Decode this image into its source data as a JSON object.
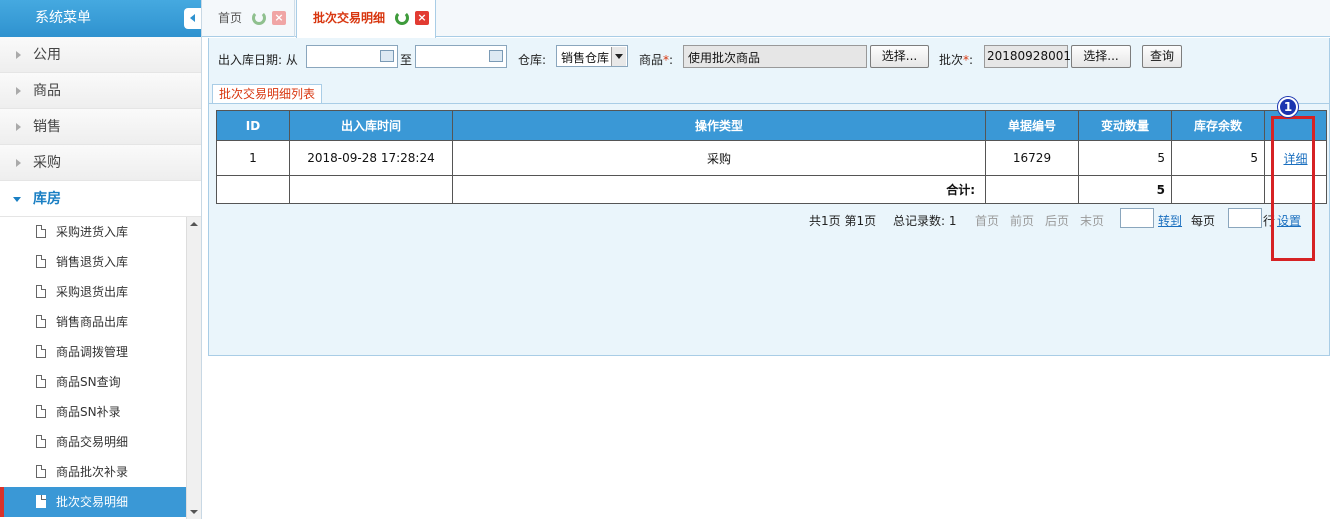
{
  "sidebar": {
    "title": "系统菜单",
    "groups": [
      {
        "label": "公用"
      },
      {
        "label": "商品"
      },
      {
        "label": "销售"
      },
      {
        "label": "采购"
      },
      {
        "label": "库房"
      }
    ],
    "items": [
      {
        "label": "采购进货入库"
      },
      {
        "label": "销售退货入库"
      },
      {
        "label": "采购退货出库"
      },
      {
        "label": "销售商品出库"
      },
      {
        "label": "商品调拨管理"
      },
      {
        "label": "商品SN查询"
      },
      {
        "label": "商品SN补录"
      },
      {
        "label": "商品交易明细"
      },
      {
        "label": "商品批次补录"
      },
      {
        "label": "批次交易明细"
      }
    ]
  },
  "tabs": [
    {
      "label": "首页"
    },
    {
      "label": "批次交易明细"
    }
  ],
  "filter": {
    "date_label": "出入库日期: 从",
    "date_from": "",
    "to_label": "至",
    "date_to": "",
    "warehouse_label": "仓库:",
    "warehouse_value": "销售仓库",
    "product_label": "商品",
    "product_value": "使用批次商品",
    "select_btn": "选择...",
    "batch_label": "批次",
    "batch_value": "20180928001",
    "select_btn2": "选择...",
    "query_btn": "查询",
    "required_mark": "*",
    "colon": ":"
  },
  "list_tab": "批次交易明细列表",
  "table": {
    "columns": [
      "ID",
      "出入库时间",
      "操作类型",
      "单据编号",
      "变动数量",
      "库存余数",
      ""
    ],
    "rows": [
      {
        "id": "1",
        "time": "2018-09-28 17:28:24",
        "type": "采购",
        "doc_no": "16729",
        "change": "5",
        "stock": "5",
        "action": "详细"
      }
    ],
    "total_label": "合计:",
    "total_change": "5"
  },
  "pager": {
    "summary": "共1页 第1页",
    "record_count": "总记录数: 1",
    "first": "首页",
    "prev": "前页",
    "next": "后页",
    "last": "末页",
    "goto": "转到",
    "per_page": "每页",
    "row_unit": "行",
    "settings": "设置"
  },
  "annotation": {
    "badge": "1",
    "color": "#d62224"
  }
}
